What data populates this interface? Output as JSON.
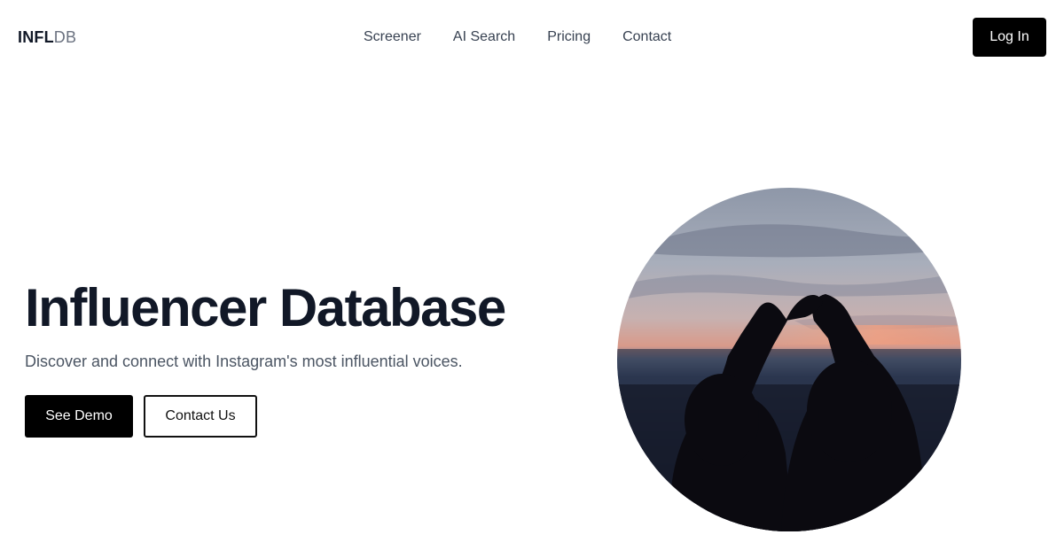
{
  "brand": {
    "logo_bold": "INFL",
    "logo_light": "DB"
  },
  "nav": {
    "links": [
      "Screener",
      "AI Search",
      "Pricing",
      "Contact"
    ],
    "login_label": "Log In"
  },
  "hero": {
    "title": "Influencer Database",
    "subtitle": "Discover and connect with Instagram's most influential voices.",
    "primary_button": "See Demo",
    "secondary_button": "Contact Us",
    "image_alt": "Two people making a heart shape with their hands against a sunset sky"
  },
  "colors": {
    "text_dark": "#111827",
    "text_muted": "#4b5563",
    "button_black": "#000000",
    "logo_light": "#6b7280"
  }
}
